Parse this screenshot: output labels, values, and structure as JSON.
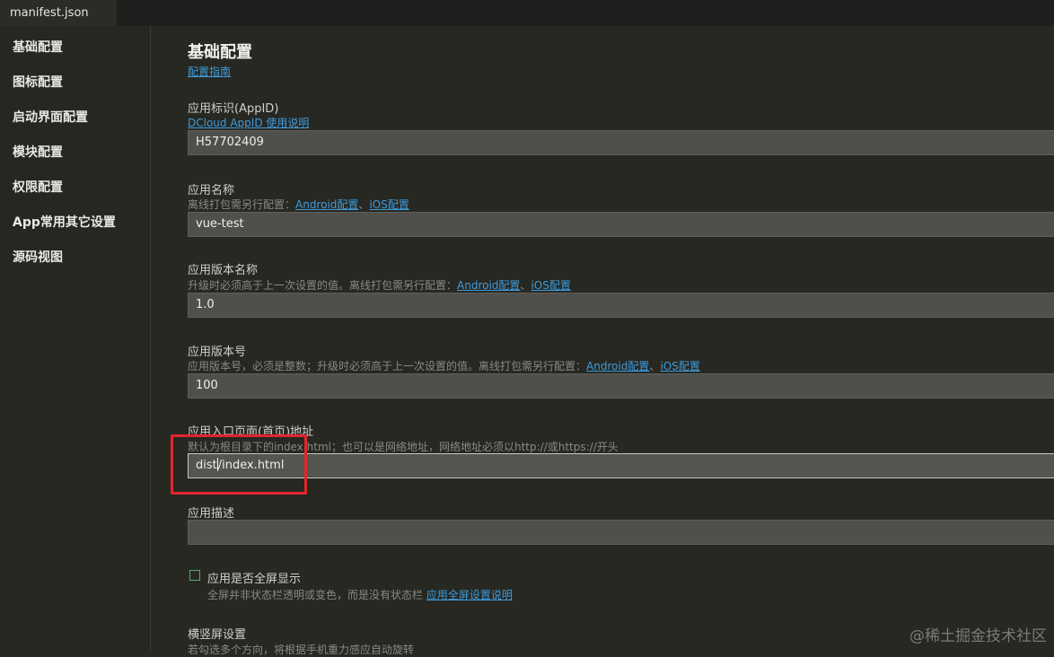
{
  "tab": {
    "title": "manifest.json"
  },
  "sidebar": {
    "items": [
      {
        "label": "基础配置"
      },
      {
        "label": "图标配置"
      },
      {
        "label": "启动界面配置"
      },
      {
        "label": "模块配置"
      },
      {
        "label": "权限配置"
      },
      {
        "label": "App常用其它设置"
      },
      {
        "label": "源码视图"
      }
    ]
  },
  "main": {
    "title": "基础配置",
    "guide_link": "配置指南",
    "appid": {
      "label": "应用标识(AppID)",
      "link": "DCloud AppID 使用说明",
      "value": "H57702409"
    },
    "app_name": {
      "label": "应用名称",
      "hint": "离线打包需另行配置：",
      "android_link": "Android配置",
      "sep": "、",
      "ios_link": "iOS配置",
      "value": "vue-test"
    },
    "version_name": {
      "label": "应用版本名称",
      "hint": "升级时必须高于上一次设置的值。离线打包需另行配置：",
      "android_link": "Android配置",
      "sep": "、",
      "ios_link": "iOS配置",
      "value": "1.0"
    },
    "version_code": {
      "label": "应用版本号",
      "hint": "应用版本号，必须是整数；升级时必须高于上一次设置的值。离线打包需另行配置：",
      "android_link": "Android配置",
      "sep": "、",
      "ios_link": "iOS配置",
      "value": "100"
    },
    "entry_page": {
      "label": "应用入口页面(首页)地址",
      "hint": "默认为根目录下的index.html；也可以是网络地址，网络地址必须以http://或https://开头",
      "value_before_caret": "dist",
      "value_after_caret": "/index.html"
    },
    "description": {
      "label": "应用描述",
      "value": ""
    },
    "fullscreen": {
      "label": "应用是否全屏显示",
      "hint": "全屏并非状态栏透明或变色，而是没有状态栏",
      "link": "应用全屏设置说明",
      "checked": false
    },
    "orientation": {
      "label": "横竖屏设置",
      "hint": "若勾选多个方向，将根据手机重力感应自动旋转"
    }
  },
  "watermark": "@稀土掘金技术社区",
  "colors": {
    "background": "#272822",
    "link": "#3e9bdb",
    "highlight": "#e3262c"
  }
}
